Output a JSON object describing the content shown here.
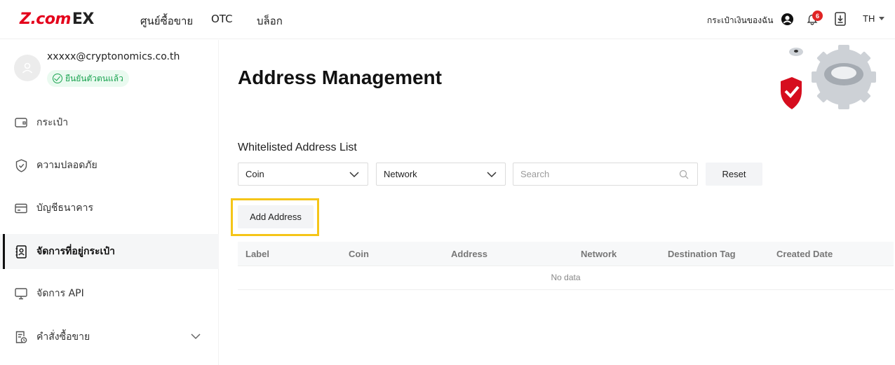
{
  "brand": {
    "logo_main": "Z.com",
    "logo_suffix": "EX"
  },
  "nav": {
    "items": [
      "ศูนย์ซื้อขาย",
      "OTC",
      "บล็อก"
    ],
    "wallet": "กระเป๋าเงินของฉัน",
    "notification_count": "6",
    "language": "TH"
  },
  "sidebar": {
    "email": "xxxxx@cryptonomics.co.th",
    "verified": "ยืนยันตัวตนแล้ว",
    "items": [
      {
        "label": "กระเป๋า",
        "icon": "wallet-icon"
      },
      {
        "label": "ความปลอดภัย",
        "icon": "shield-icon"
      },
      {
        "label": "บัญชีธนาคาร",
        "icon": "card-icon"
      },
      {
        "label": "จัดการที่อยู่กระเป๋า",
        "icon": "address-book-icon",
        "active": true
      },
      {
        "label": "จัดการ API",
        "icon": "monitor-icon"
      },
      {
        "label": "คำสั่งซื้อขาย",
        "icon": "order-icon"
      }
    ]
  },
  "main": {
    "title": "Address Management",
    "section_title": "Whitelisted Address List",
    "filters": {
      "coin": "Coin",
      "network": "Network",
      "search_placeholder": "Search",
      "reset": "Reset"
    },
    "add_button": "Add Address",
    "table": {
      "columns": [
        "Label",
        "Coin",
        "Address",
        "Network",
        "Destination Tag",
        "Created Date"
      ],
      "empty": "No data"
    }
  },
  "colors": {
    "accent": "#e4001b",
    "highlight": "#f5c518",
    "verified": "#1aa350"
  }
}
